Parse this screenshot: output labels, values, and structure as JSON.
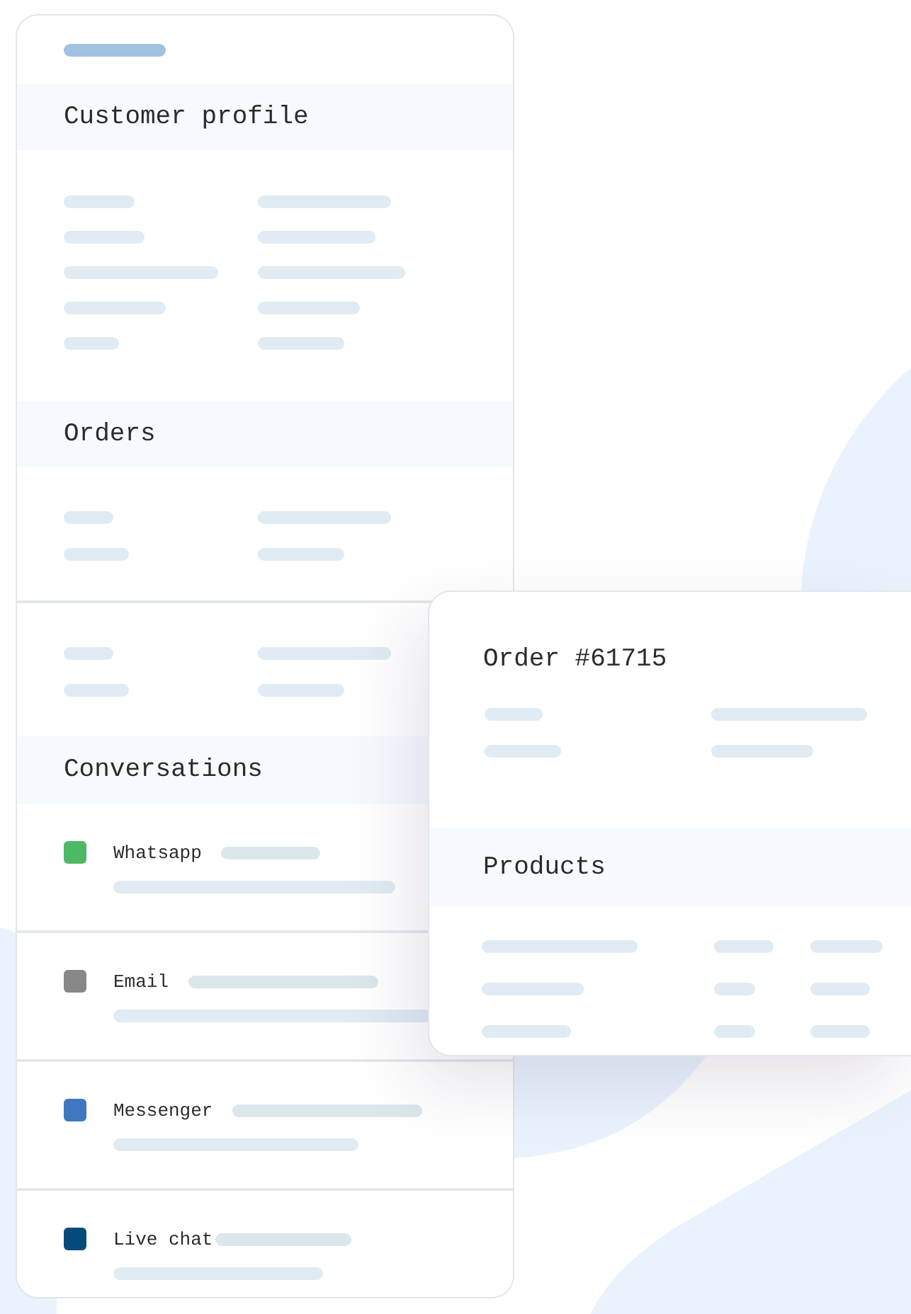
{
  "customer_profile": {
    "title": "Customer profile"
  },
  "orders": {
    "title": "Orders"
  },
  "conversations": {
    "title": "Conversations",
    "items": [
      {
        "label": "Whatsapp",
        "color": "#4cb964"
      },
      {
        "label": "Email",
        "color": "#888888"
      },
      {
        "label": "Messenger",
        "color": "#3f78c1"
      },
      {
        "label": "Live chat",
        "color": "#064a7c"
      }
    ]
  },
  "order_detail": {
    "title": "Order #61715",
    "products_title": "Products"
  }
}
